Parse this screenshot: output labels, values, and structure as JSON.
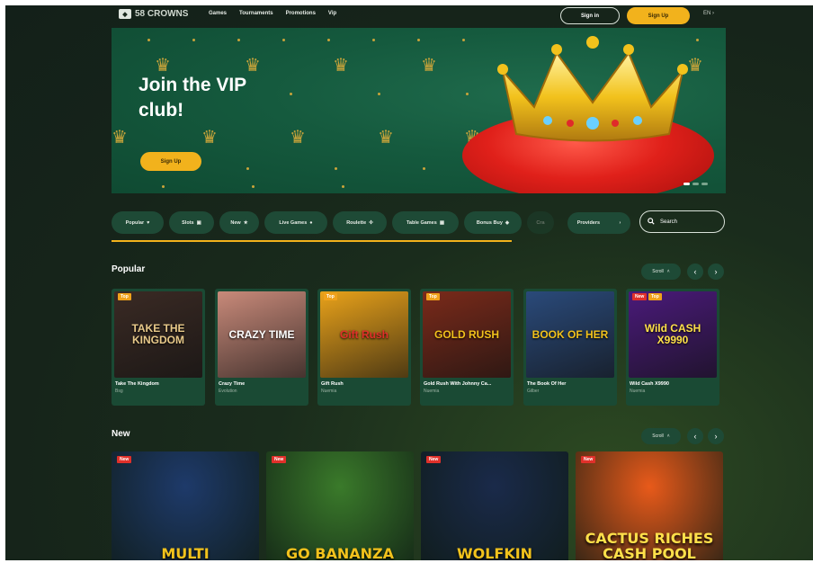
{
  "header": {
    "logo_text": "58 CROWNS",
    "nav": [
      "Games",
      "Tournaments",
      "Promotions",
      "Vip"
    ],
    "signin_label": "Sign in",
    "signup_label": "Sign Up",
    "language": "EN"
  },
  "banner": {
    "title": "Join the VIP club!",
    "button_label": "Sign Up"
  },
  "categories": [
    {
      "label": "Popular",
      "icon": "heart-icon"
    },
    {
      "label": "Slots",
      "icon": "slot-icon"
    },
    {
      "label": "New",
      "icon": "star-icon"
    },
    {
      "label": "Live Games",
      "icon": "live-icon"
    },
    {
      "label": "Roulette",
      "icon": "roulette-icon"
    },
    {
      "label": "Table Games",
      "icon": "table-icon"
    },
    {
      "label": "Bonus Buy",
      "icon": "bonus-icon"
    },
    {
      "label": "Cra",
      "icon": ""
    }
  ],
  "providers_label": "Providers",
  "search": {
    "placeholder": "Search"
  },
  "popular": {
    "title": "Popular",
    "scroll_label": "Scroll",
    "games": [
      {
        "name": "Take The Kingdom",
        "provider": "Bsg",
        "tags": [
          "Top"
        ],
        "art": "TAKE THE KINGDOM",
        "bg": "#3a2a24",
        "fg": "#e8c98a"
      },
      {
        "name": "Crazy Time",
        "provider": "Evolution",
        "tags": [],
        "art": "CRAZY TIME",
        "bg": "#c98a7a",
        "fg": "#ffffff"
      },
      {
        "name": "Gift Rush",
        "provider": "Nuemia",
        "tags": [
          "Top"
        ],
        "art": "Gift Rush",
        "bg": "#e9a21a",
        "fg": "#e0302a"
      },
      {
        "name": "Gold Rush With Johnny Ca...",
        "provider": "Nuemia",
        "tags": [
          "Top"
        ],
        "art": "GOLD RUSH",
        "bg": "#7a2a1a",
        "fg": "#f2c21c"
      },
      {
        "name": "The Book Of Her",
        "provider": "Gilber",
        "tags": [],
        "art": "BOOK OF HER",
        "bg": "#2a4a7a",
        "fg": "#f2c21c"
      },
      {
        "name": "Wild Cash X9990",
        "provider": "Nuemia",
        "tags": [
          "New",
          "Top"
        ],
        "art": "Wild CASH X9990",
        "bg": "#4a1a7a",
        "fg": "#ffe04a"
      }
    ]
  },
  "new": {
    "title": "New",
    "scroll_label": "Scroll",
    "games": [
      {
        "tag": "New",
        "art": "MULTI",
        "bg": "#1e3a6a",
        "fg": "#f2c21c"
      },
      {
        "tag": "New",
        "art": "GO BANANZA",
        "bg": "#3a7a2a",
        "fg": "#f2c21c"
      },
      {
        "tag": "New",
        "art": "WOLFKIN",
        "bg": "#1a2a4a",
        "fg": "#f2c21c"
      },
      {
        "tag": "New",
        "art": "CACTUS RICHES CASH POOL",
        "bg": "#e85a1a",
        "fg": "#ffe04a"
      }
    ]
  }
}
